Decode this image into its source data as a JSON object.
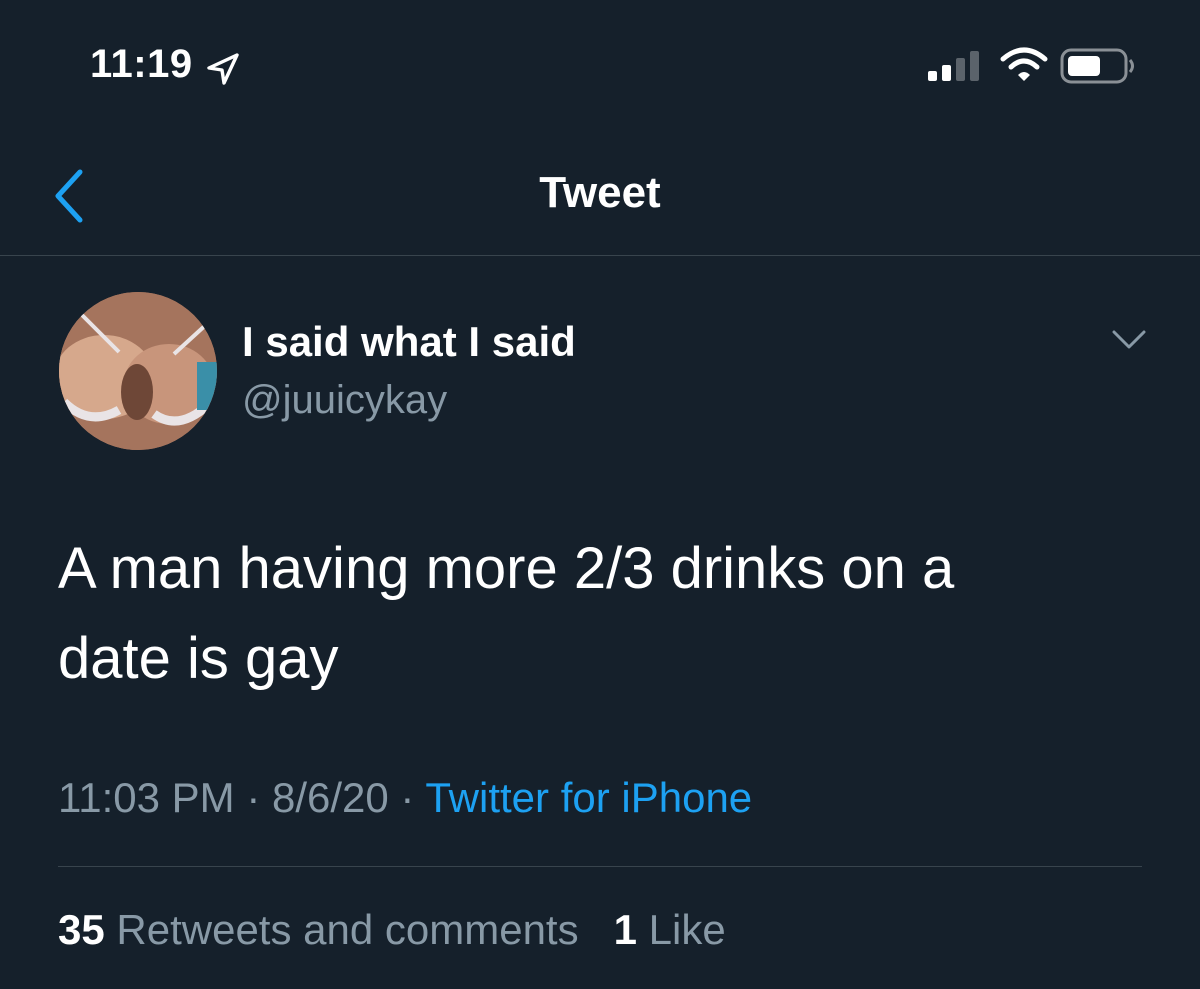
{
  "status_bar": {
    "time": "11:19",
    "icons": [
      "location-arrow-icon",
      "cellular-signal-icon",
      "wifi-icon",
      "battery-icon"
    ]
  },
  "nav": {
    "title": "Tweet",
    "back_icon": "chevron-left-icon"
  },
  "tweet": {
    "display_name": "I said what I said",
    "handle": "@juuicykay",
    "more_icon": "chevron-down-icon",
    "text_line1": "A man having more 2/3 drinks on a",
    "text_line2": "date is gay",
    "time": "11:03 PM",
    "separator": " · ",
    "date": "8/6/20",
    "source": "Twitter for iPhone",
    "retweets_count": "35",
    "retweets_label": "Retweets and comments",
    "likes_count": "1",
    "likes_label": "Like"
  },
  "colors": {
    "background": "#15202b",
    "text_primary": "#ffffff",
    "text_secondary": "#8899a6",
    "accent": "#1da1f2",
    "divider": "#38444d"
  }
}
